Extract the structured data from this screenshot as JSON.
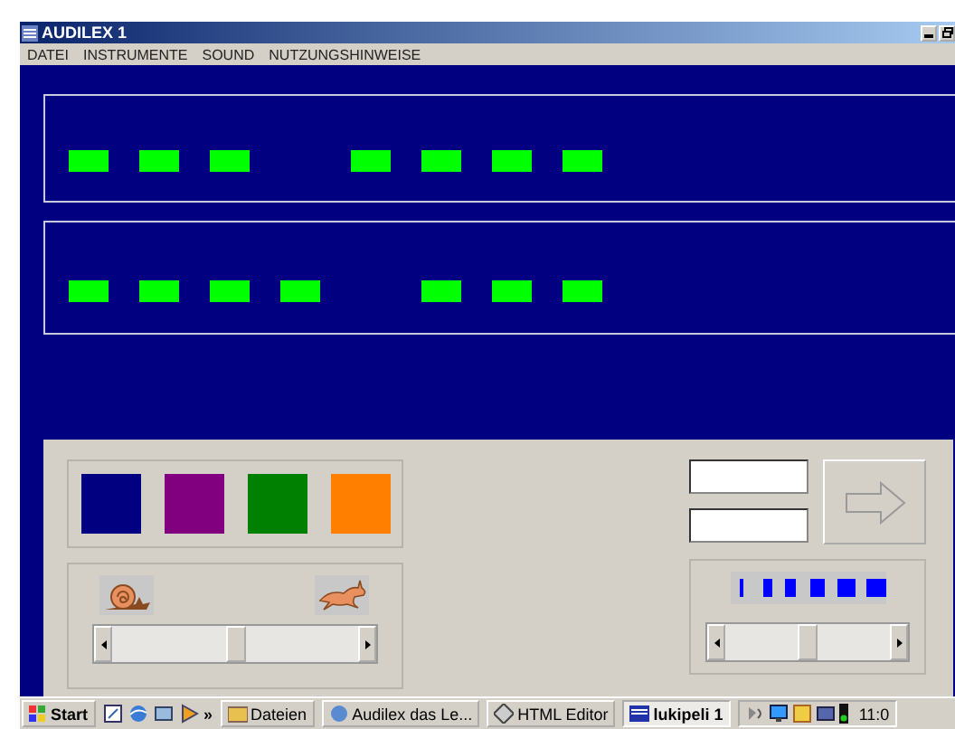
{
  "window": {
    "title": "AUDILEX 1"
  },
  "menu": [
    "DATEI",
    "INSTRUMENTE",
    "SOUND",
    "NUTZUNGSHINWEISE"
  ],
  "patterns": [
    {
      "slots": [
        {
          "filled": true
        },
        {
          "filled": true
        },
        {
          "filled": true
        },
        {
          "filled": false
        },
        {
          "filled": true
        },
        {
          "filled": true
        },
        {
          "filled": true
        },
        {
          "filled": true
        }
      ]
    },
    {
      "slots": [
        {
          "filled": true
        },
        {
          "filled": true
        },
        {
          "filled": true
        },
        {
          "filled": true
        },
        {
          "filled": false
        },
        {
          "filled": true
        },
        {
          "filled": true
        },
        {
          "filled": true
        }
      ]
    }
  ],
  "swatches": [
    {
      "color": "#000080"
    },
    {
      "color": "#800080"
    },
    {
      "color": "#008000"
    },
    {
      "color": "#ff8000"
    }
  ],
  "speed_slider": {
    "level": 0.5
  },
  "length_slider": {
    "level": 0.5
  },
  "answer_fields": [
    {
      "kind": "text"
    },
    {
      "kind": "text"
    }
  ],
  "next_button": {
    "disabled": true
  },
  "taskbar": {
    "start": "Start",
    "more": "»",
    "tasks": [
      {
        "label": "Dateien",
        "selected": false
      },
      {
        "label": "Audilex das Le...",
        "selected": false
      },
      {
        "label": "HTML Editor",
        "selected": false
      },
      {
        "label": "lukipeli 1",
        "selected": true
      }
    ],
    "clock": "11:0"
  }
}
